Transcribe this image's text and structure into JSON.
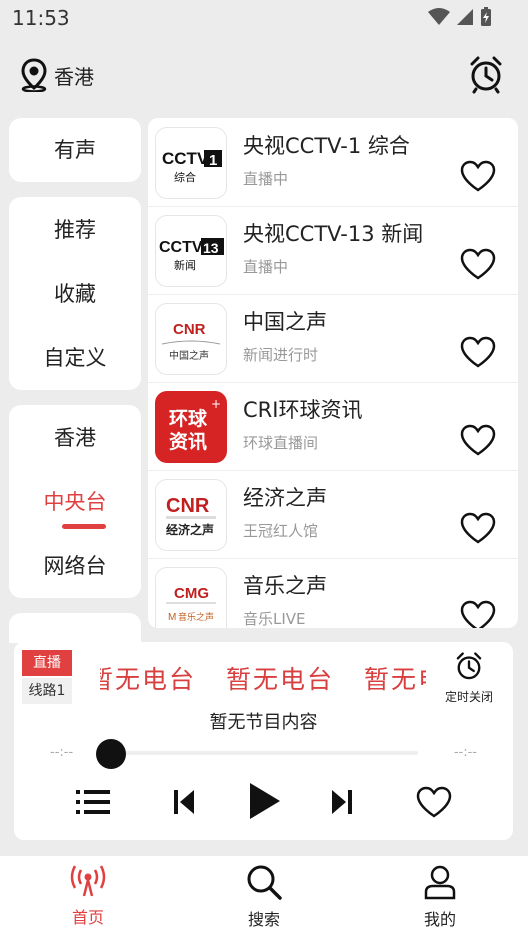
{
  "status_bar": {
    "time": "11:53"
  },
  "header": {
    "location": "香港"
  },
  "categories": {
    "group1": [
      "有声"
    ],
    "group2": [
      "推荐",
      "收藏",
      "自定义"
    ],
    "group3": [
      "香港",
      "中央台",
      "网络台"
    ],
    "active": "中央台"
  },
  "stations": [
    {
      "title": "央视CCTV-1 综合",
      "subtitle": "直播中",
      "logo": "CCTV-1 综合"
    },
    {
      "title": "央视CCTV-13 新闻",
      "subtitle": "直播中",
      "logo": "CCTV-13 新闻"
    },
    {
      "title": "中国之声",
      "subtitle": "新闻进行时",
      "logo": "CNR 中国之声"
    },
    {
      "title": "CRI环球资讯",
      "subtitle": "环球直播间",
      "logo": "环球资讯"
    },
    {
      "title": "经济之声",
      "subtitle": "王冠红人馆",
      "logo": "CNR 经济之声"
    },
    {
      "title": "音乐之声",
      "subtitle": "音乐LIVE",
      "logo": "CMG 音乐之声"
    }
  ],
  "player": {
    "live_label": "直播",
    "line_label": "线路1",
    "marquee_text": "暂无电台",
    "timer_label": "定时关闭",
    "program": "暂无节目内容",
    "time_current": "--:--",
    "time_total": "--:--",
    "progress": 0
  },
  "tabbar": {
    "home": "首页",
    "search": "搜索",
    "mine": "我的"
  },
  "colors": {
    "accent": "#e04040",
    "background": "#ececec"
  }
}
